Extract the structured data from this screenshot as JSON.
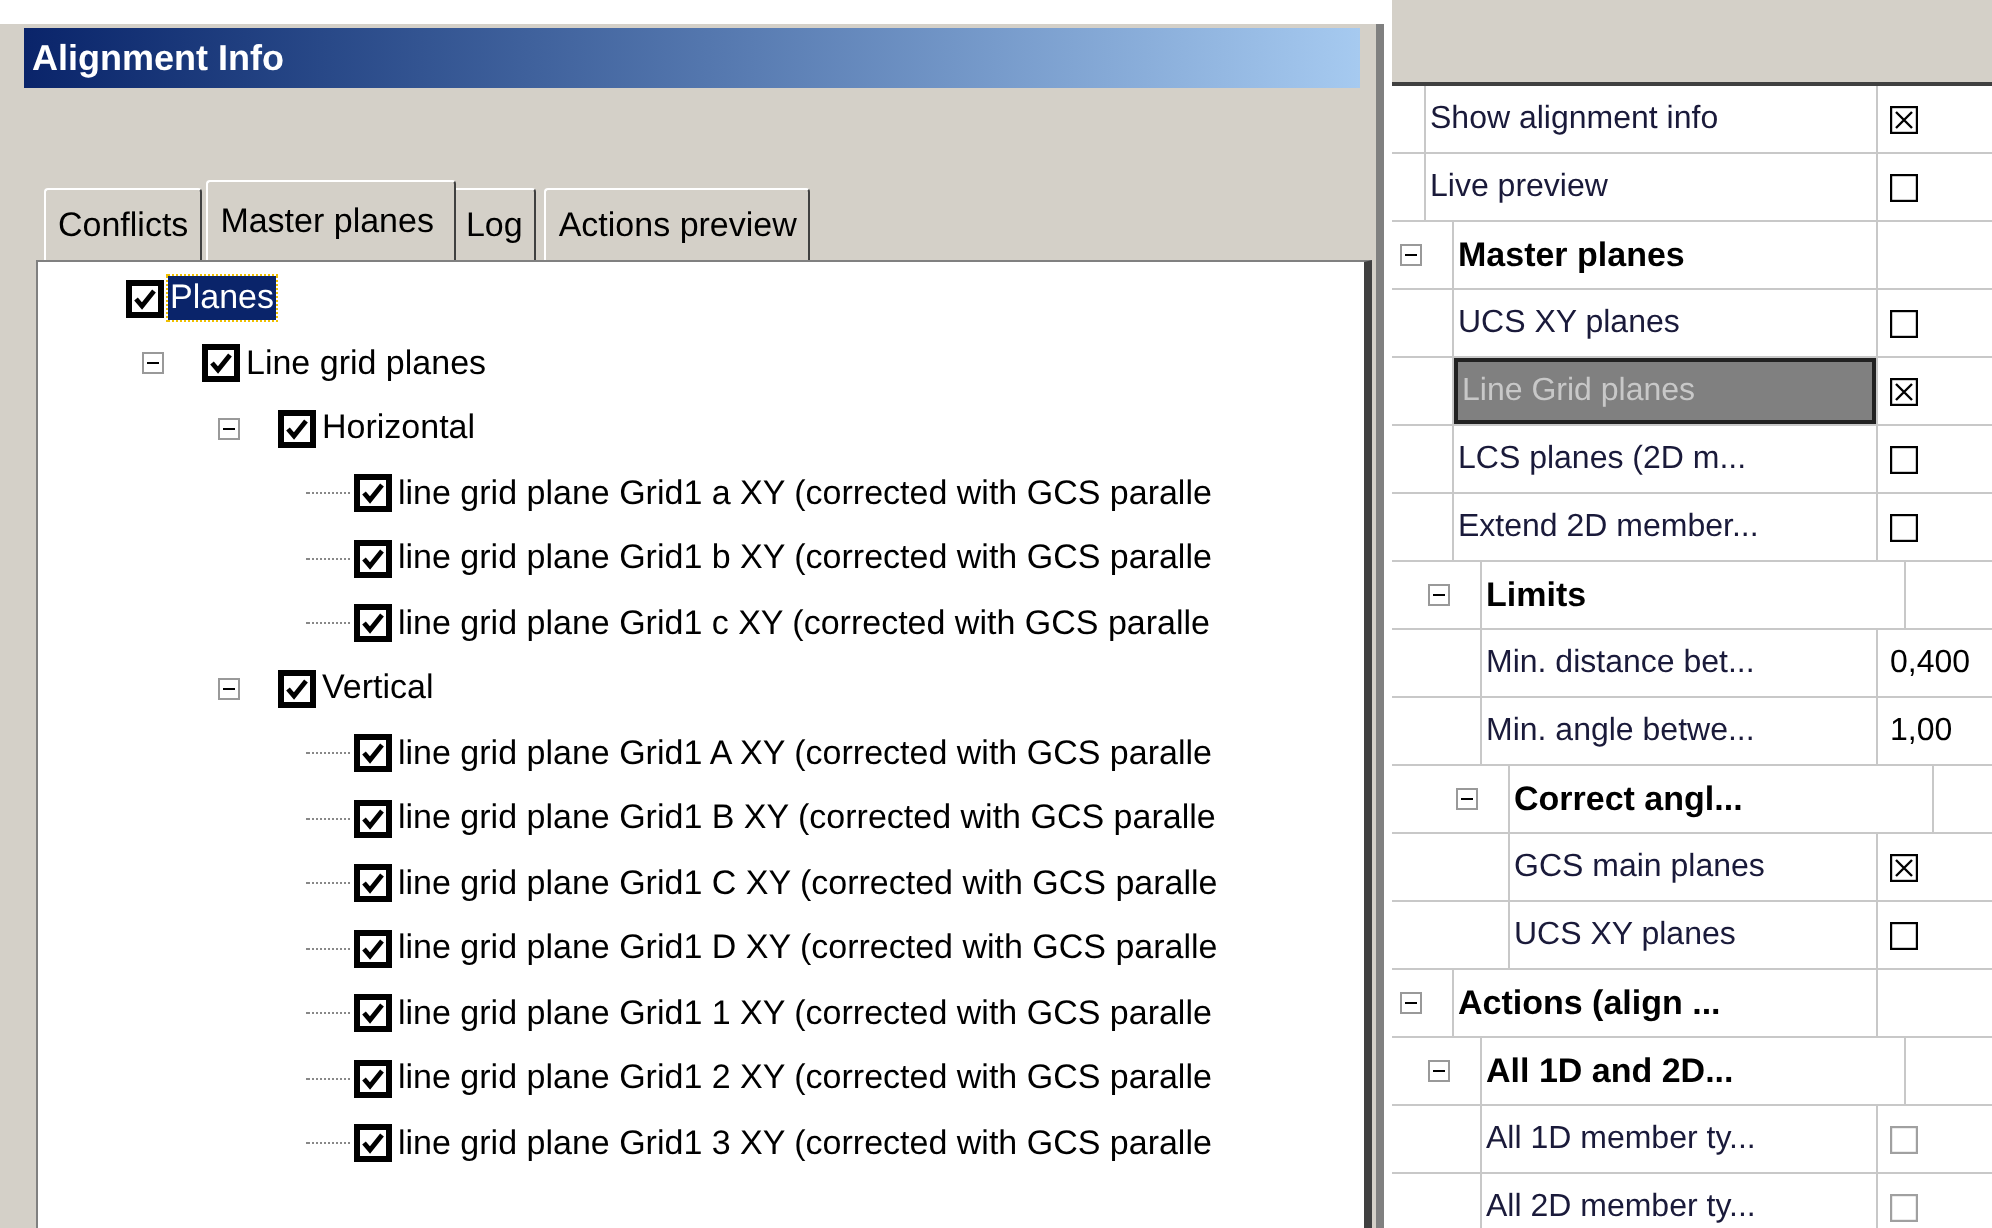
{
  "window": {
    "title": "Alignment Info"
  },
  "tabs": [
    {
      "label": "Conflicts",
      "selected": false
    },
    {
      "label": "Master planes",
      "selected": true
    },
    {
      "label": "Log",
      "selected": false
    },
    {
      "label": "Actions preview",
      "selected": false
    }
  ],
  "tree": [
    {
      "label": "Planes",
      "checked": true,
      "selected": true,
      "children": [
        {
          "label": "Line grid planes",
          "checked": true,
          "selected": false,
          "expanded": true,
          "children": [
            {
              "label": "Horizontal",
              "checked": true,
              "selected": false,
              "expanded": true,
              "children": [
                {
                  "label": "line grid plane Grid1 a XY (corrected with GCS paralle",
                  "checked": true,
                  "selected": false
                },
                {
                  "label": "line grid plane Grid1 b XY (corrected with GCS paralle",
                  "checked": true,
                  "selected": false
                },
                {
                  "label": "line grid plane Grid1 c XY (corrected with GCS paralle",
                  "checked": true,
                  "selected": false
                }
              ]
            },
            {
              "label": "Vertical",
              "checked": true,
              "selected": false,
              "expanded": true,
              "children": [
                {
                  "label": "line grid plane Grid1 A XY (corrected with GCS paralle",
                  "checked": true,
                  "selected": false
                },
                {
                  "label": "line grid plane Grid1 B XY (corrected with GCS paralle",
                  "checked": true,
                  "selected": false
                },
                {
                  "label": "line grid plane Grid1 C XY (corrected with GCS paralle",
                  "checked": true,
                  "selected": false
                },
                {
                  "label": "line grid plane Grid1 D XY (corrected with GCS paralle",
                  "checked": true,
                  "selected": false
                },
                {
                  "label": "line grid plane Grid1 1 XY (corrected with GCS paralle",
                  "checked": true,
                  "selected": false
                },
                {
                  "label": "line grid plane Grid1 2 XY (corrected with GCS paralle",
                  "checked": true,
                  "selected": false
                },
                {
                  "label": "line grid plane Grid1 3 XY (corrected with GCS paralle",
                  "checked": true,
                  "selected": false
                }
              ]
            }
          ]
        }
      ]
    }
  ],
  "properties": [
    {
      "kind": "checkbox",
      "label": "Show alignment info",
      "checked": true,
      "selected": false
    },
    {
      "kind": "checkbox",
      "label": "Live preview",
      "checked": false,
      "selected": false
    },
    {
      "kind": "category",
      "label": "Master planes",
      "expanded": true,
      "children": [
        {
          "kind": "checkbox",
          "label": "UCS XY planes",
          "checked": false,
          "selected": false
        },
        {
          "kind": "checkbox",
          "label": "Line Grid planes",
          "checked": true,
          "selected": true
        },
        {
          "kind": "checkbox",
          "label": "LCS planes (2D m...",
          "checked": false,
          "selected": false
        },
        {
          "kind": "checkbox",
          "label": "Extend 2D member...",
          "checked": false,
          "selected": false
        },
        {
          "kind": "category",
          "label": "Limits",
          "expanded": true,
          "children": [
            {
              "kind": "text",
              "label": "Min. distance bet...",
              "value": "0,400",
              "selected": false
            },
            {
              "kind": "text",
              "label": "Min. angle betwe...",
              "value": "1,00",
              "selected": false
            },
            {
              "kind": "category",
              "label": "Correct angl...",
              "expanded": true,
              "children": [
                {
                  "kind": "checkbox",
                  "label": "GCS main planes",
                  "checked": true,
                  "selected": false
                },
                {
                  "kind": "checkbox",
                  "label": "UCS XY planes",
                  "checked": false,
                  "selected": false
                }
              ]
            }
          ]
        }
      ]
    },
    {
      "kind": "category",
      "label": "Actions (align ...",
      "expanded": true,
      "children": [
        {
          "kind": "category",
          "label": "All 1D and 2D...",
          "expanded": true,
          "children": [
            {
              "kind": "checkbox",
              "label": "All 1D member ty...",
              "checked": false,
              "selected": false,
              "disabled": true
            },
            {
              "kind": "checkbox",
              "label": "All 2D member ty...",
              "checked": false,
              "selected": false,
              "disabled": true
            }
          ]
        }
      ]
    }
  ]
}
